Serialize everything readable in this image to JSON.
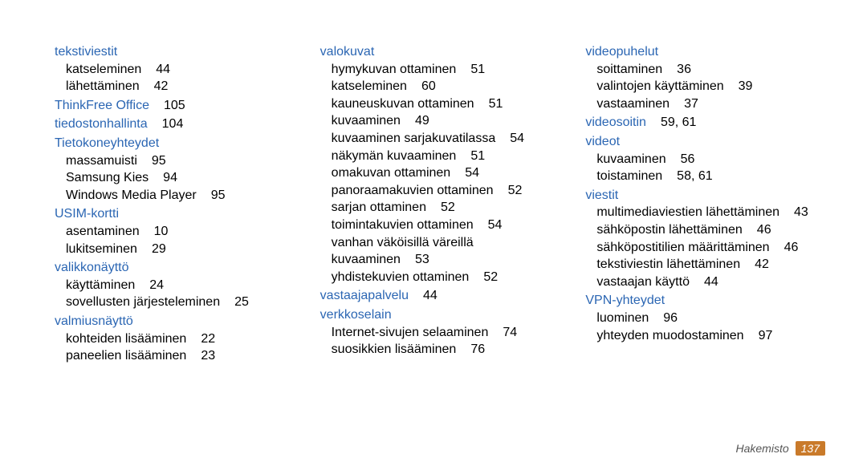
{
  "footer": {
    "label": "Hakemisto",
    "page": "137"
  },
  "columns": [
    [
      {
        "type": "heading",
        "text": "tekstiviestit"
      },
      {
        "type": "sub",
        "text": "katseleminen",
        "page": "44"
      },
      {
        "type": "sub",
        "text": "lähettäminen",
        "page": "42"
      },
      {
        "type": "heading",
        "text": "ThinkFree Office",
        "page": "105"
      },
      {
        "type": "heading",
        "text": "tiedostonhallinta",
        "page": "104"
      },
      {
        "type": "heading",
        "text": "Tietokoneyhteydet"
      },
      {
        "type": "sub",
        "text": "massamuisti",
        "page": "95"
      },
      {
        "type": "sub",
        "text": "Samsung Kies",
        "page": "94"
      },
      {
        "type": "sub",
        "text": "Windows Media Player",
        "page": "95"
      },
      {
        "type": "heading",
        "text": "USIM-kortti"
      },
      {
        "type": "sub",
        "text": "asentaminen",
        "page": "10"
      },
      {
        "type": "sub",
        "text": "lukitseminen",
        "page": "29"
      },
      {
        "type": "heading",
        "text": "valikkonäyttö"
      },
      {
        "type": "sub",
        "text": "käyttäminen",
        "page": "24"
      },
      {
        "type": "sub",
        "text": "sovellusten järjesteleminen",
        "page": "25"
      },
      {
        "type": "heading",
        "text": "valmiusnäyttö"
      },
      {
        "type": "sub",
        "text": "kohteiden lisääminen",
        "page": "22"
      },
      {
        "type": "sub",
        "text": "paneelien lisääminen",
        "page": "23"
      }
    ],
    [
      {
        "type": "heading",
        "text": "valokuvat"
      },
      {
        "type": "sub",
        "text": "hymykuvan ottaminen",
        "page": "51"
      },
      {
        "type": "sub",
        "text": "katseleminen",
        "page": "60"
      },
      {
        "type": "sub",
        "text": "kauneuskuvan ottaminen",
        "page": "51"
      },
      {
        "type": "sub",
        "text": "kuvaaminen",
        "page": "49"
      },
      {
        "type": "sub",
        "text": "kuvaaminen sarjakuvatilassa",
        "page": "54"
      },
      {
        "type": "sub",
        "text": "näkymän kuvaaminen",
        "page": "51"
      },
      {
        "type": "sub",
        "text": "omakuvan ottaminen",
        "page": "54"
      },
      {
        "type": "sub",
        "text": "panoraamakuvien ottaminen",
        "page": "52"
      },
      {
        "type": "sub",
        "text": "sarjan ottaminen",
        "page": "52"
      },
      {
        "type": "sub",
        "text": "toimintakuvien ottaminen",
        "page": "54"
      },
      {
        "type": "sub",
        "text": "vanhan väköisillä väreillä kuvaaminen",
        "page": "53",
        "multiline": true
      },
      {
        "type": "sub",
        "text": "yhdistekuvien ottaminen",
        "page": "52"
      },
      {
        "type": "heading",
        "text": "vastaajapalvelu",
        "page": "44"
      },
      {
        "type": "heading",
        "text": "verkkoselain"
      },
      {
        "type": "sub",
        "text": "Internet-sivujen selaaminen",
        "page": "74"
      },
      {
        "type": "sub",
        "text": "suosikkien lisääminen",
        "page": "76"
      }
    ],
    [
      {
        "type": "heading",
        "text": "videopuhelut"
      },
      {
        "type": "sub",
        "text": "soittaminen",
        "page": "36"
      },
      {
        "type": "sub",
        "text": "valintojen käyttäminen",
        "page": "39"
      },
      {
        "type": "sub",
        "text": "vastaaminen",
        "page": "37"
      },
      {
        "type": "heading",
        "text": "videosoitin",
        "page": "59, 61"
      },
      {
        "type": "heading",
        "text": "videot"
      },
      {
        "type": "sub",
        "text": "kuvaaminen",
        "page": "56"
      },
      {
        "type": "sub",
        "text": "toistaminen",
        "page": "58, 61"
      },
      {
        "type": "heading",
        "text": "viestit"
      },
      {
        "type": "sub",
        "text": "multimediaviestien lähettäminen",
        "page": "43",
        "multiline": true
      },
      {
        "type": "sub",
        "text": "sähköpostin lähettäminen",
        "page": "46"
      },
      {
        "type": "sub",
        "text": "sähköpostitilien määrittäminen",
        "page": "46"
      },
      {
        "type": "sub",
        "text": "tekstiviestin lähettäminen",
        "page": "42"
      },
      {
        "type": "sub",
        "text": "vastaajan käyttö",
        "page": "44"
      },
      {
        "type": "heading",
        "text": "VPN-yhteydet"
      },
      {
        "type": "sub",
        "text": "luominen",
        "page": "96"
      },
      {
        "type": "sub",
        "text": "yhteyden muodostaminen",
        "page": "97"
      }
    ]
  ]
}
